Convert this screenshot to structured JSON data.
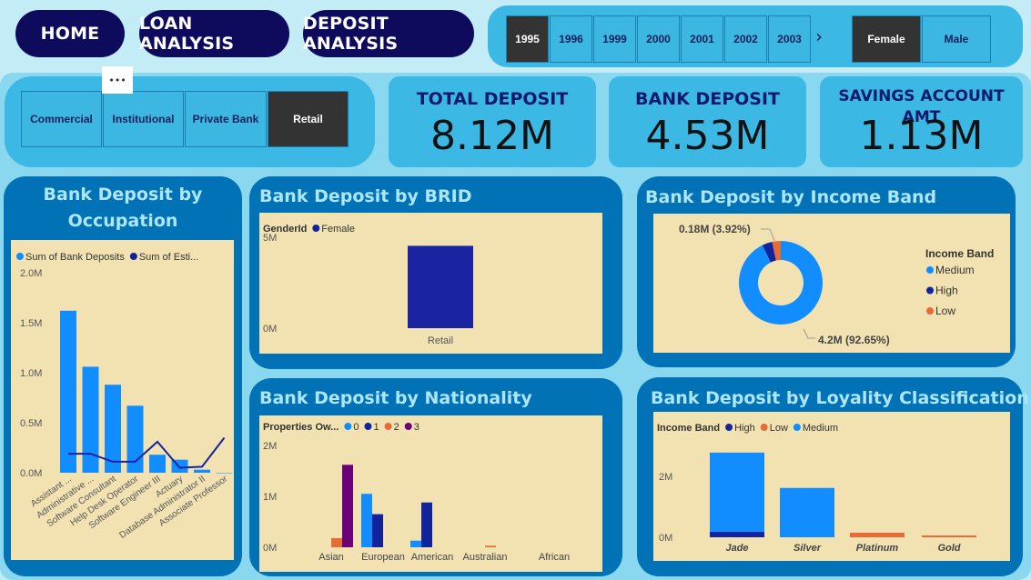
{
  "nav": {
    "home": "HOME",
    "loan": "LOAN ANALYSIS",
    "deposit": "DEPOSIT ANALYSIS"
  },
  "years": [
    "1995",
    "1996",
    "1999",
    "2000",
    "2001",
    "2002",
    "2003"
  ],
  "selected_year": "1995",
  "more_chevron": "›",
  "genders": [
    "Female",
    "Male"
  ],
  "selected_gender": "Female",
  "segments": [
    "Commercial",
    "Institutional",
    "Private Bank",
    "Retail"
  ],
  "selected_segment": "Retail",
  "more_options": "•••",
  "kpis": [
    {
      "title": "TOTAL DEPOSIT",
      "value": "8.12M"
    },
    {
      "title": "BANK DEPOSIT",
      "value": "4.53M"
    },
    {
      "title": "SAVINGS ACCOUNT AMT",
      "value": "1.13M"
    }
  ],
  "colors": {
    "light_blue": "#118dff",
    "navy": "#12239e",
    "orange": "#e66c37",
    "purple": "#6b007b",
    "plot_bg": "#f2e2b2",
    "panel": "#0072b5"
  },
  "chart_data": [
    {
      "id": "occupation",
      "type": "bar",
      "title": "Bank Deposit by Occupation",
      "legend": [
        "Sum of Bank Deposits",
        "Sum of Esti..."
      ],
      "categories": [
        "Assistant ...",
        "Administrative ...",
        "Software Consultant",
        "Help Desk Operator",
        "Software Engineer III",
        "Actuary",
        "Database Administrator II",
        "Associate Professor"
      ],
      "series": [
        {
          "name": "Sum of Bank Deposits",
          "type": "bar",
          "values": [
            1.62,
            1.06,
            0.88,
            0.67,
            0.18,
            0.13,
            0.03,
            0.0
          ]
        },
        {
          "name": "Sum of Esti...",
          "type": "line",
          "values": [
            0.19,
            0.19,
            0.11,
            0.11,
            0.31,
            0.05,
            0.06,
            0.35
          ]
        }
      ],
      "ylim": [
        0,
        2.0
      ],
      "yticks": [
        "0.0M",
        "0.5M",
        "1.0M",
        "1.5M",
        "2.0M"
      ]
    },
    {
      "id": "brid",
      "type": "bar",
      "title": "Bank Deposit by BRID",
      "legend_title": "GenderId",
      "legend": [
        "Female"
      ],
      "categories": [
        "Retail"
      ],
      "series": [
        {
          "name": "Female",
          "values": [
            4.53
          ]
        }
      ],
      "ylim": [
        0,
        7
      ],
      "yticks": [
        "0M",
        "5M"
      ]
    },
    {
      "id": "income",
      "type": "pie",
      "title": "Bank Deposit by  Income Band",
      "legend_title": "Income Band",
      "legend": [
        "Medium",
        "High",
        "Low"
      ],
      "values": [
        4.2,
        0.18,
        0.15
      ],
      "labels": [
        "4.2M (92.65%)",
        "0.18M (3.92%)"
      ]
    },
    {
      "id": "nationality",
      "type": "bar",
      "title": "Bank Deposit by  Nationality",
      "legend_title": "Properties Ow...",
      "legend": [
        "0",
        "1",
        "2",
        "3"
      ],
      "categories": [
        "Asian",
        "European",
        "American",
        "Australian",
        "African"
      ],
      "series": [
        {
          "name": "0",
          "values": [
            0,
            1.05,
            0.13,
            0,
            0
          ]
        },
        {
          "name": "1",
          "values": [
            0,
            0.65,
            0.88,
            0,
            0
          ]
        },
        {
          "name": "2",
          "values": [
            0.18,
            0,
            0,
            0.03,
            0
          ]
        },
        {
          "name": "3",
          "values": [
            1.62,
            0,
            0,
            0,
            0
          ]
        }
      ],
      "ylim": [
        0,
        2.2
      ],
      "yticks": [
        "0M",
        "1M",
        "2M"
      ]
    },
    {
      "id": "loyalty",
      "type": "bar",
      "stacked": true,
      "title": "Bank Deposit by Loyality Classification",
      "legend_title": "Income Band",
      "legend": [
        "High",
        "Low",
        "Medium"
      ],
      "categories": [
        "Jade",
        "Silver",
        "Platinum",
        "Gold"
      ],
      "series": [
        {
          "name": "High",
          "values": [
            0.18,
            0,
            0,
            0
          ]
        },
        {
          "name": "Low",
          "values": [
            0,
            0,
            0.15,
            0.03
          ]
        },
        {
          "name": "Medium",
          "values": [
            2.6,
            1.62,
            0,
            0
          ]
        }
      ],
      "ylim": [
        0,
        3.3
      ],
      "yticks": [
        "0M",
        "2M"
      ]
    }
  ]
}
